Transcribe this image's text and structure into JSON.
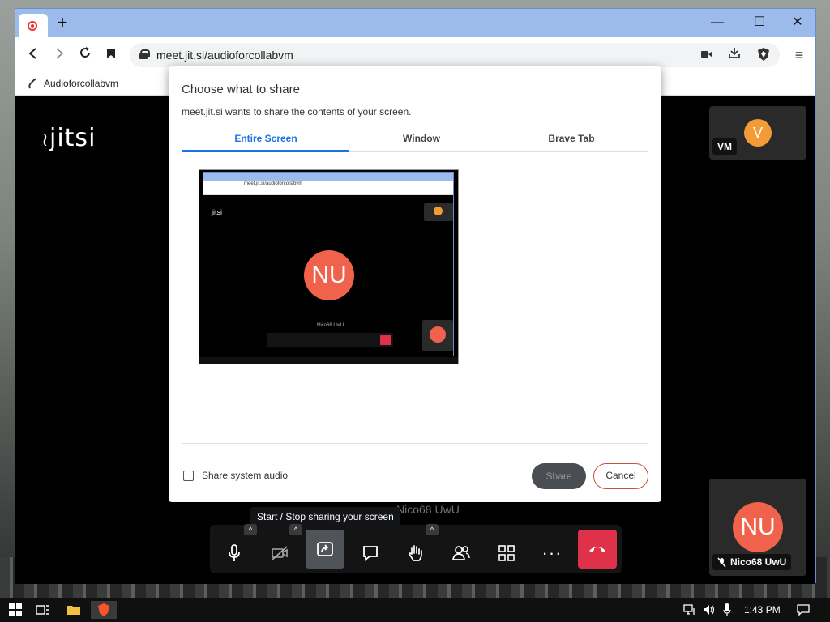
{
  "browser": {
    "url": "meet.jit.si/audioforcollabvm",
    "bookmark_label": "Audioforcollabvm",
    "new_tab_symbol": "+",
    "window_controls": {
      "minimize": "—",
      "maximize": "☐",
      "close": "✕"
    }
  },
  "meeting": {
    "logo_text": "jitsi",
    "participant_vm": {
      "initial": "V",
      "name_tag": "VM",
      "avatar_color": "#f39b37"
    },
    "participant_self": {
      "initials": "NU",
      "name": "Nico68 UwU",
      "avatar_color": "#f0624c"
    },
    "tooltip": "Start / Stop sharing your screen",
    "background_text": "Nico68 UwU",
    "hangup_color": "#e0314b"
  },
  "dialog": {
    "title": "Choose what to share",
    "subtitle": "meet.jit.si wants to share the contents of your screen.",
    "tabs": [
      {
        "label": "Entire Screen",
        "active": true
      },
      {
        "label": "Window",
        "active": false
      },
      {
        "label": "Brave Tab",
        "active": false
      }
    ],
    "preview": {
      "url": "meet.jit.si/audioforcollabvm",
      "logo": "jitsi",
      "initials": "NU",
      "caption": "Nico68 UwU"
    },
    "checkbox_label": "Share system audio",
    "share_label": "Share",
    "cancel_label": "Cancel"
  },
  "taskbar": {
    "time": "1:43 PM"
  }
}
